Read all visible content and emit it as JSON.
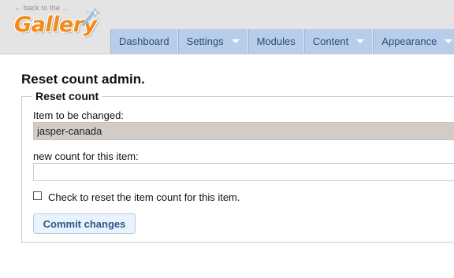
{
  "header": {
    "back_link": "← back to the ...",
    "logo_text": "Gallery",
    "colors": {
      "logo": "#f28a1c",
      "nav_bg": "#b8cdea",
      "nav_text": "#2a4d7a"
    }
  },
  "nav": {
    "items": [
      {
        "label": "Dashboard",
        "has_dropdown": false
      },
      {
        "label": "Settings",
        "has_dropdown": true
      },
      {
        "label": "Modules",
        "has_dropdown": false
      },
      {
        "label": "Content",
        "has_dropdown": true
      },
      {
        "label": "Appearance",
        "has_dropdown": true
      }
    ]
  },
  "main": {
    "title": "Reset count admin.",
    "form": {
      "legend": "Reset count",
      "item_label": "Item to be changed:",
      "item_value": "jasper-canada",
      "count_label": "new count for this item:",
      "count_value": "",
      "checkbox_label": "Check to reset the item count for this item.",
      "checkbox_checked": false,
      "submit_label": "Commit changes"
    }
  }
}
